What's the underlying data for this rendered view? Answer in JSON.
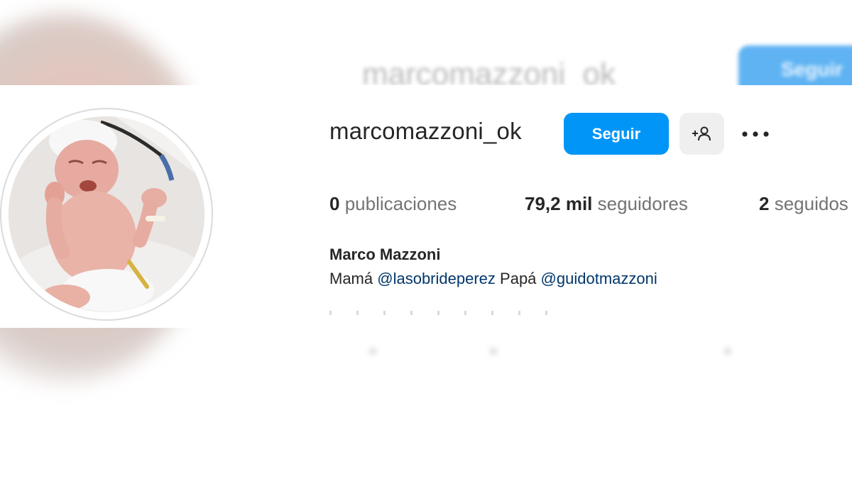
{
  "profile": {
    "username": "marcomazzoni_ok",
    "full_name": "Marco Mazzoni",
    "bio": {
      "prefix_1": "Mamá",
      "mention_1": "@lasobrideperez",
      "prefix_2": "Papá",
      "mention_2": "@guidotmazzoni"
    },
    "avatar_icon": "newborn-baby-photo"
  },
  "actions": {
    "follow_label": "Seguir",
    "suggest_icon": "add-person-icon",
    "more_icon": "more-options-icon"
  },
  "stats": {
    "posts_value": "0",
    "posts_label": "publicaciones",
    "followers_value": "79,2 mil",
    "followers_label": "seguidores",
    "following_value": "2",
    "following_label": "seguidos"
  },
  "colors": {
    "primary_button": "#0095f6",
    "secondary_button": "#efefef",
    "mention_link": "#00376b",
    "text": "#262626",
    "muted_text": "#737373"
  }
}
